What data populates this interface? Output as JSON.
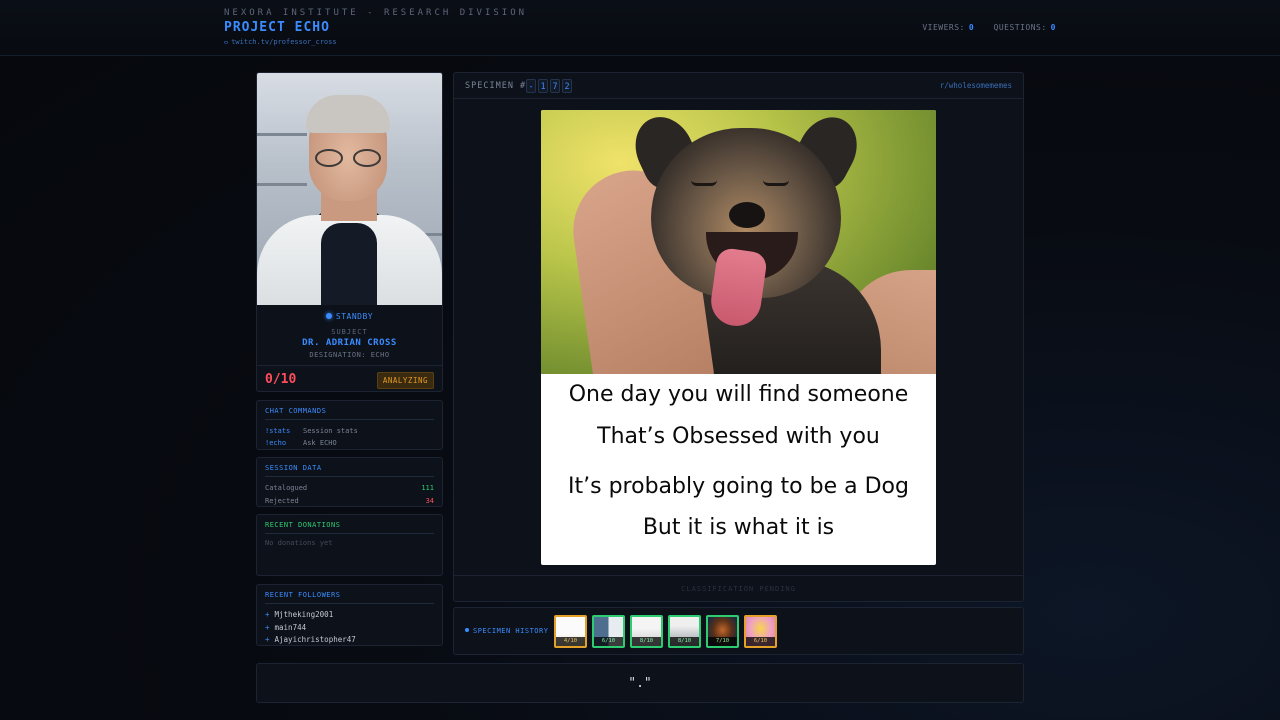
{
  "header": {
    "org": "NEXORA INSTITUTE - RESEARCH DIVISION",
    "project": "PROJECT ECHO",
    "channel_link": "twitch.tv/professor_cross",
    "viewers_label": "VIEWERS:",
    "viewers_value": "0",
    "questions_label": "QUESTIONS:",
    "questions_value": "0"
  },
  "profile": {
    "status": "STANDBY",
    "subject_label": "SUBJECT",
    "name": "DR. ADRIAN CROSS",
    "designation": "DESIGNATION: ECHO",
    "score": "0/10",
    "state_badge": "ANALYZING"
  },
  "chat_commands": {
    "title": "CHAT COMMANDS",
    "items": [
      {
        "cmd": "!stats",
        "desc": "Session stats"
      },
      {
        "cmd": "!echo",
        "desc": "Ask ECHO"
      }
    ]
  },
  "session": {
    "title": "SESSION DATA",
    "catalogued_label": "Catalogued",
    "catalogued_value": "111",
    "rejected_label": "Rejected",
    "rejected_value": "34"
  },
  "donations": {
    "title": "RECENT DONATIONS",
    "empty": "No donations yet"
  },
  "followers": {
    "title": "RECENT FOLLOWERS",
    "items": [
      "Mjtheking2001",
      "main744",
      "Ajayichristopher47"
    ]
  },
  "viewer": {
    "specimen_label": "SPECIMEN #",
    "digits": [
      "-",
      "1",
      "7",
      "2"
    ],
    "subreddit": "r/wholesomememes",
    "meme_lines": [
      "One day you will find someone",
      "That’s Obsessed with you",
      "It’s probably going to be a Dog",
      "But it is what it is"
    ],
    "classification": "CLASSIFICATION PENDING"
  },
  "history": {
    "title": "SPECIMEN HISTORY",
    "scores": [
      "4/10",
      "6/10",
      "8/10",
      "8/10",
      "7/10",
      "6/10"
    ],
    "border_colors": [
      "orange",
      "green",
      "green",
      "green",
      "green",
      "orange"
    ]
  },
  "footer": {
    "text": "\".\""
  }
}
